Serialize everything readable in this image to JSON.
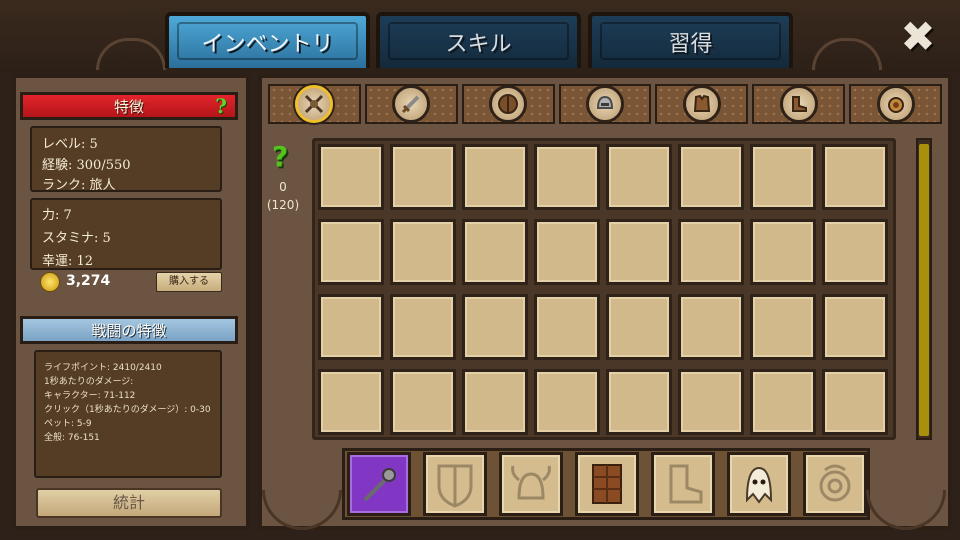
{
  "tabs": [
    {
      "label": "インベントリ",
      "active": true
    },
    {
      "label": "スキル",
      "active": false
    },
    {
      "label": "習得",
      "active": false
    }
  ],
  "close": {
    "glyph": "✖"
  },
  "traits": {
    "title": "特徴",
    "help": "?",
    "level": "レベル: 5",
    "exp": "経験: 300/550",
    "rank": "ランク: 旅人",
    "strength": "力: 7",
    "stamina": "スタミナ: 5",
    "luck": "幸運: 12",
    "gold": "3,274",
    "buy_label": "購入する"
  },
  "combat": {
    "title": "戦闘の特徴",
    "life": "ライフポイント: 2410/2410",
    "dps_title": "1秒あたりのダメージ:",
    "character": "キャラクター: 71-112",
    "click": "クリック（1秒あたりのダメージ）: 0-30",
    "pet": "ペット: 5-9",
    "total": "全般: 76-151"
  },
  "stats_button": "統計",
  "categories": [
    {
      "icon": "crossed-axes-icon",
      "selected": true
    },
    {
      "icon": "sword-icon",
      "selected": false
    },
    {
      "icon": "shield-icon",
      "selected": false
    },
    {
      "icon": "helmet-icon",
      "selected": false
    },
    {
      "icon": "armor-icon",
      "selected": false
    },
    {
      "icon": "boots-icon",
      "selected": false
    },
    {
      "icon": "amulet-icon",
      "selected": false
    }
  ],
  "inventory": {
    "help": "?",
    "count": "0",
    "capacity": "(120)",
    "rows": 4,
    "cols": 8
  },
  "equipment": [
    {
      "slot": "weapon",
      "icon": "mace-icon",
      "equipped": true
    },
    {
      "slot": "shield",
      "icon": "shield-icon",
      "equipped": false
    },
    {
      "slot": "helmet",
      "icon": "horned-helmet-icon",
      "equipped": false
    },
    {
      "slot": "armor",
      "icon": "leather-armor-icon",
      "equipped": true
    },
    {
      "slot": "boots",
      "icon": "boot-icon",
      "equipped": false
    },
    {
      "slot": "pet",
      "icon": "ghost-pet-icon",
      "equipped": true
    },
    {
      "slot": "amulet",
      "icon": "amulet-icon",
      "equipped": false
    }
  ],
  "colors": {
    "accent_red": "#e3242b",
    "accent_blue": "#4ea9d8",
    "help_green": "#52c41d",
    "equip_purple": "#8236c4"
  }
}
